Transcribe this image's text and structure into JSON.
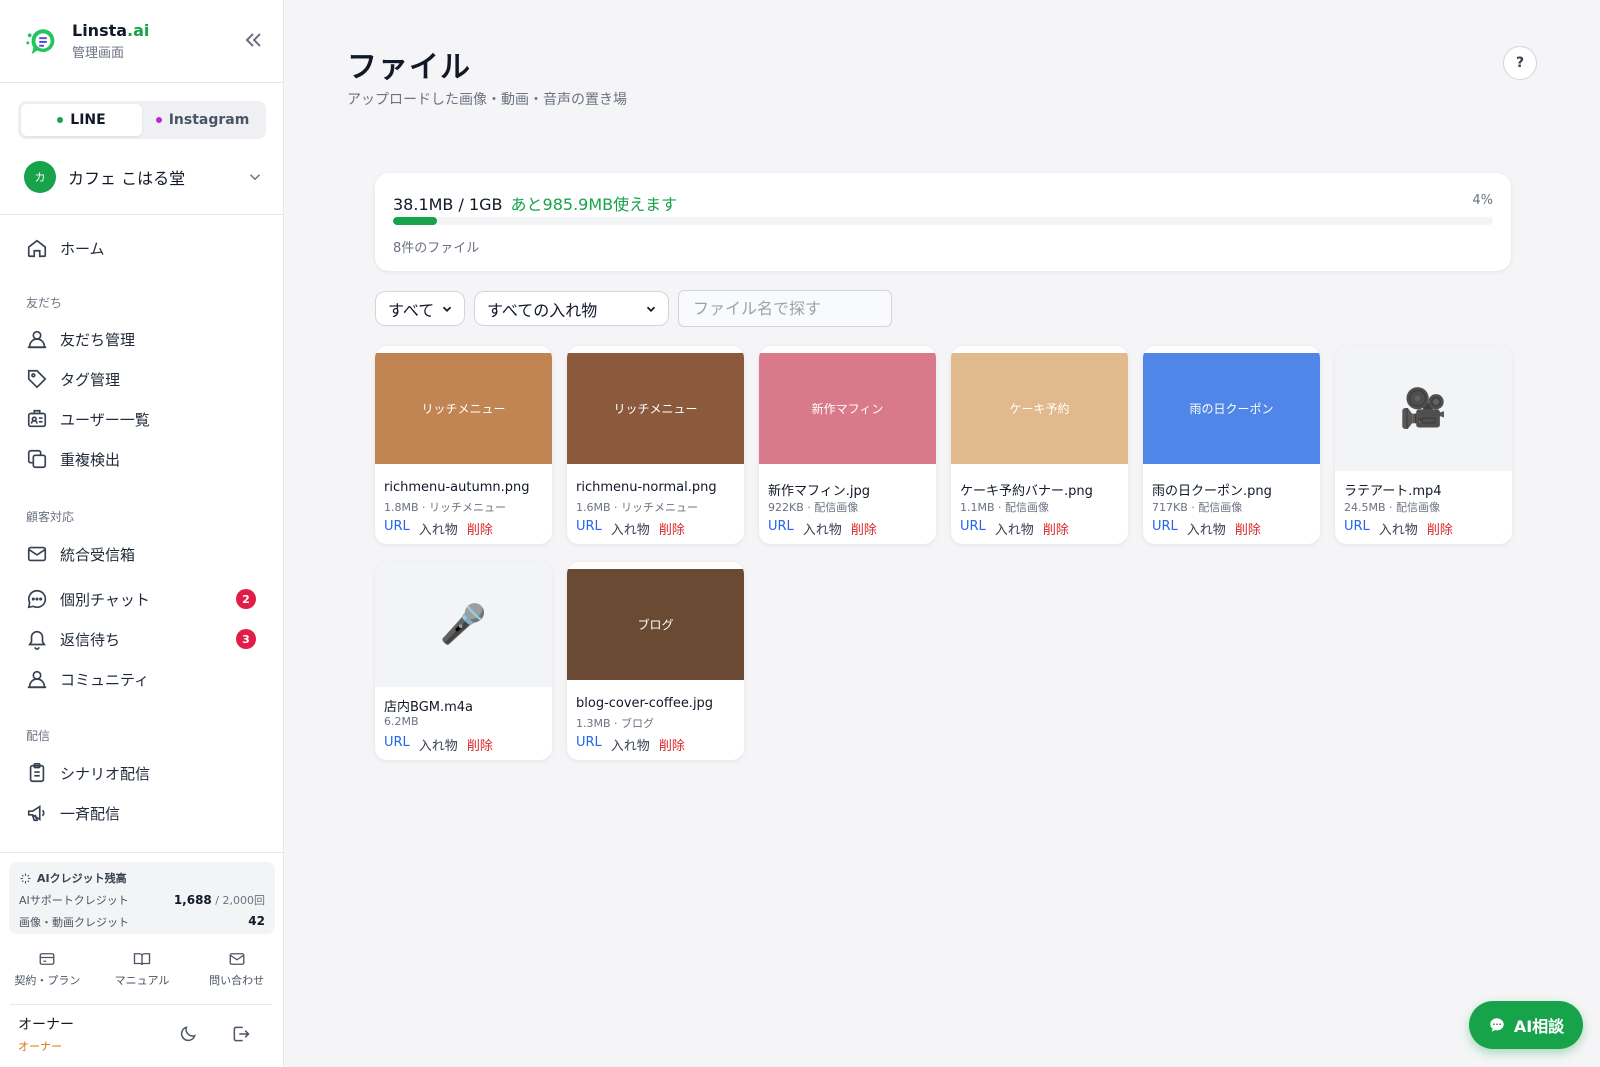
{
  "brand": {
    "name": "Linsta",
    "name_suffix": ".ai",
    "subtitle": "管理画面"
  },
  "channels": [
    {
      "label": "LINE",
      "active": true,
      "color": "#16a34a"
    },
    {
      "label": "Instagram",
      "active": false,
      "color": "#c026d3"
    }
  ],
  "account": {
    "initial": "カ",
    "name": "カフェ こはる堂"
  },
  "nav": {
    "home": "ホーム",
    "sections": {
      "friends": "友だち",
      "support": "顧客対応",
      "delivery": "配信"
    },
    "items": {
      "friends_manage": "友だち管理",
      "tags": "タグ管理",
      "users": "ユーザー一覧",
      "duplicates": "重複検出",
      "inbox": "統合受信箱",
      "chat": "個別チャット",
      "waiting": "返信待ち",
      "community": "コミュニティ",
      "scenario": "シナリオ配信",
      "broadcast": "一斉配信"
    },
    "badges": {
      "chat": "2",
      "waiting": "3"
    }
  },
  "credits": {
    "title": "AIクレジット残高",
    "support_label": "AIサポートクレジット",
    "support_value": "1,688",
    "support_total": "/ 2,000回",
    "media_label": "画像・動画クレジット",
    "media_value": "42"
  },
  "footer": {
    "contract": "契約・プラン",
    "manual": "マニュアル",
    "contact": "問い合わせ",
    "owner_name": "オーナー",
    "owner_role": "オーナー"
  },
  "page": {
    "title": "ファイル",
    "subtitle": "アップロードした画像・動画・音声の置き場",
    "help": "?"
  },
  "storage": {
    "used": "38.1MB / 1GB",
    "remaining": "あと985.9MB使えます",
    "percent_label": "4%",
    "percent": 4,
    "count": "8件のファイル"
  },
  "filters": {
    "type": "すべて",
    "container": "すべての入れ物",
    "search_placeholder": "ファイル名で探す"
  },
  "actions": {
    "url": "URL",
    "container": "入れ物",
    "delete": "削除"
  },
  "files": [
    {
      "thumb_label": "リッチメニュー",
      "thumb_color": "#c08552",
      "name": "richmenu-autumn.png",
      "size": "1.8MB",
      "category": "リッチメニュー"
    },
    {
      "thumb_label": "リッチメニュー",
      "thumb_color": "#8b5a3c",
      "name": "richmenu-normal.png",
      "size": "1.6MB",
      "category": "リッチメニュー"
    },
    {
      "thumb_label": "新作マフィン",
      "thumb_color": "#d97a8a",
      "name": "新作マフィン.jpg",
      "size": "922KB",
      "category": "配信画像"
    },
    {
      "thumb_label": "ケーキ予約",
      "thumb_color": "#e0b98c",
      "name": "ケーキ予約バナー.png",
      "size": "1.1MB",
      "category": "配信画像"
    },
    {
      "thumb_label": "雨の日クーポン",
      "thumb_color": "#4f86e8",
      "name": "雨の日クーポン.png",
      "size": "717KB",
      "category": "配信画像"
    },
    {
      "thumb_icon": "video-camera-icon",
      "thumb_glyph": "🎥",
      "name": "ラテアート.mp4",
      "size": "24.5MB",
      "category": "配信画像"
    },
    {
      "thumb_icon": "microphone-icon",
      "thumb_glyph": "🎤",
      "name": "店内BGM.m4a",
      "size": "6.2MB",
      "category": ""
    },
    {
      "thumb_label": "ブログ",
      "thumb_color": "#6b4a33",
      "name": "blog-cover-coffee.jpg",
      "size": "1.3MB",
      "category": "ブログ"
    }
  ],
  "ai_button": {
    "label": "AI相談"
  }
}
